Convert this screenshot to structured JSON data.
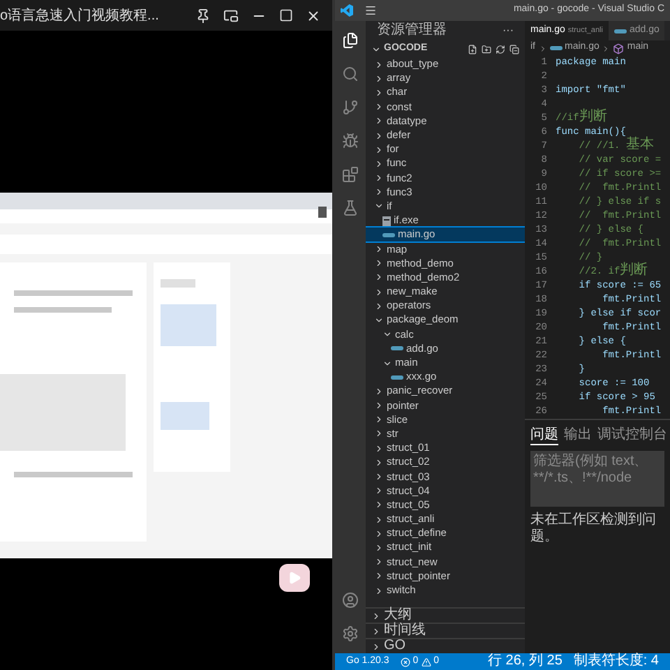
{
  "video_window": {
    "title": "o语言急速入门视频教程..."
  },
  "vscode": {
    "title": "main.go - gocode - Visual Studio C",
    "explorer": {
      "header": "资源管理器",
      "more": "···",
      "root": "GOCODE",
      "root_expanded": true,
      "tree": [
        {
          "name": "about_type",
          "kind": "folder",
          "expanded": false,
          "selected": false
        },
        {
          "name": "array",
          "kind": "folder",
          "expanded": false,
          "selected": false
        },
        {
          "name": "char",
          "kind": "folder",
          "expanded": false,
          "selected": false
        },
        {
          "name": "const",
          "kind": "folder",
          "expanded": false,
          "selected": false
        },
        {
          "name": "datatype",
          "kind": "folder",
          "expanded": false,
          "selected": false
        },
        {
          "name": "defer",
          "kind": "folder",
          "expanded": false,
          "selected": false
        },
        {
          "name": "for",
          "kind": "folder",
          "expanded": false,
          "selected": false
        },
        {
          "name": "func",
          "kind": "folder",
          "expanded": false,
          "selected": false
        },
        {
          "name": "func2",
          "kind": "folder",
          "expanded": false,
          "selected": false
        },
        {
          "name": "func3",
          "kind": "folder",
          "expanded": false,
          "selected": false
        },
        {
          "name": "if",
          "kind": "folder",
          "expanded": true,
          "selected": false,
          "children": [
            {
              "name": "if.exe",
              "kind": "exe",
              "selected": false
            },
            {
              "name": "main.go",
              "kind": "go",
              "selected": true
            }
          ]
        },
        {
          "name": "map",
          "kind": "folder",
          "expanded": false,
          "selected": false
        },
        {
          "name": "method_demo",
          "kind": "folder",
          "expanded": false,
          "selected": false
        },
        {
          "name": "method_demo2",
          "kind": "folder",
          "expanded": false,
          "selected": false
        },
        {
          "name": "new_make",
          "kind": "folder",
          "expanded": false,
          "selected": false
        },
        {
          "name": "operators",
          "kind": "folder",
          "expanded": false,
          "selected": false
        },
        {
          "name": "package_deom",
          "kind": "folder",
          "expanded": true,
          "selected": false,
          "children": [
            {
              "name": "calc",
              "kind": "folder",
              "expanded": true,
              "selected": false,
              "children": [
                {
                  "name": "add.go",
                  "kind": "go",
                  "selected": false
                }
              ]
            },
            {
              "name": "main",
              "kind": "folder",
              "expanded": true,
              "selected": false,
              "children": [
                {
                  "name": "xxx.go",
                  "kind": "go",
                  "selected": false
                }
              ]
            }
          ]
        },
        {
          "name": "panic_recover",
          "kind": "folder",
          "expanded": false,
          "selected": false
        },
        {
          "name": "pointer",
          "kind": "folder",
          "expanded": false,
          "selected": false
        },
        {
          "name": "slice",
          "kind": "folder",
          "expanded": false,
          "selected": false
        },
        {
          "name": "str",
          "kind": "folder",
          "expanded": false,
          "selected": false
        },
        {
          "name": "struct_01",
          "kind": "folder",
          "expanded": false,
          "selected": false
        },
        {
          "name": "struct_02",
          "kind": "folder",
          "expanded": false,
          "selected": false
        },
        {
          "name": "struct_03",
          "kind": "folder",
          "expanded": false,
          "selected": false
        },
        {
          "name": "struct_04",
          "kind": "folder",
          "expanded": false,
          "selected": false
        },
        {
          "name": "struct_05",
          "kind": "folder",
          "expanded": false,
          "selected": false
        },
        {
          "name": "struct_anli",
          "kind": "folder",
          "expanded": false,
          "selected": false
        },
        {
          "name": "struct_define",
          "kind": "folder",
          "expanded": false,
          "selected": false
        },
        {
          "name": "struct_init",
          "kind": "folder",
          "expanded": false,
          "selected": false
        },
        {
          "name": "struct_new",
          "kind": "folder",
          "expanded": false,
          "selected": false
        },
        {
          "name": "struct_pointer",
          "kind": "folder",
          "expanded": false,
          "selected": false
        },
        {
          "name": "switch",
          "kind": "folder",
          "expanded": false,
          "selected": false
        }
      ],
      "sections": [
        {
          "label": "大纲",
          "expanded": false
        },
        {
          "label": "时间线",
          "expanded": false
        },
        {
          "label": "GO",
          "expanded": false
        }
      ]
    },
    "tabs": [
      {
        "label": "main.go",
        "detail": "struct_anli",
        "icon": false,
        "selected": true
      },
      {
        "label": "add.go",
        "icon": true,
        "selected": false
      }
    ],
    "breadcrumb": [
      {
        "label": "if",
        "kind": "folder"
      },
      {
        "label": "main.go",
        "kind": "go"
      },
      {
        "label": "main",
        "kind": "function"
      }
    ],
    "code": [
      {
        "n": "1",
        "kind": "code",
        "text": "package main"
      },
      {
        "n": "2"
      },
      {
        "n": "3",
        "kind": "code",
        "text": "import \"fmt\""
      },
      {
        "n": "4"
      },
      {
        "n": "5",
        "kind": "comment",
        "text": "//if判断"
      },
      {
        "n": "6",
        "kind": "code",
        "text": "func main(){"
      },
      {
        "n": "7",
        "kind": "comment",
        "text": "    // //1. 基本"
      },
      {
        "n": "8",
        "kind": "comment",
        "text": "    // var score ="
      },
      {
        "n": "9",
        "kind": "comment",
        "text": "    // if score >="
      },
      {
        "n": "10",
        "kind": "comment",
        "text": "    //  fmt.Printl"
      },
      {
        "n": "11",
        "kind": "comment",
        "text": "    // } else if s"
      },
      {
        "n": "12",
        "kind": "comment",
        "text": "    //  fmt.Printl"
      },
      {
        "n": "13",
        "kind": "comment",
        "text": "    // } else {"
      },
      {
        "n": "14",
        "kind": "comment",
        "text": "    //  fmt.Printl"
      },
      {
        "n": "15",
        "kind": "comment",
        "text": "    // }"
      },
      {
        "n": "16",
        "kind": "comment",
        "text": "    //2. if判断"
      },
      {
        "n": "17",
        "kind": "code",
        "text": "    if score := 65"
      },
      {
        "n": "18",
        "kind": "code",
        "text": "        fmt.Printl"
      },
      {
        "n": "19",
        "kind": "code",
        "text": "    } else if scor"
      },
      {
        "n": "20",
        "kind": "code",
        "text": "        fmt.Printl"
      },
      {
        "n": "21",
        "kind": "code",
        "text": "    } else {"
      },
      {
        "n": "22",
        "kind": "code",
        "text": "        fmt.Printl"
      },
      {
        "n": "23",
        "kind": "code",
        "text": "    }"
      },
      {
        "n": "24",
        "kind": "code",
        "text": "    score := 100"
      },
      {
        "n": "25",
        "kind": "code",
        "text": "    if score > 95"
      },
      {
        "n": "26",
        "kind": "code",
        "text": "        fmt.Printl"
      }
    ],
    "panel": {
      "tabs": [
        {
          "label": "问题",
          "selected": true
        },
        {
          "label": "输出",
          "selected": false
        },
        {
          "label": "调试控制台",
          "selected": false
        }
      ],
      "filter": {
        "placeholder": "筛选器(例如 text、**/*.ts、!**/node"
      },
      "message": "未在工作区检测到问题。"
    },
    "status_bar": {
      "go_version": "Go 1.20.3",
      "errors": "0",
      "warnings": "0",
      "position": "行 26, 列 25",
      "tab_size": "制表符长度: 4"
    }
  }
}
